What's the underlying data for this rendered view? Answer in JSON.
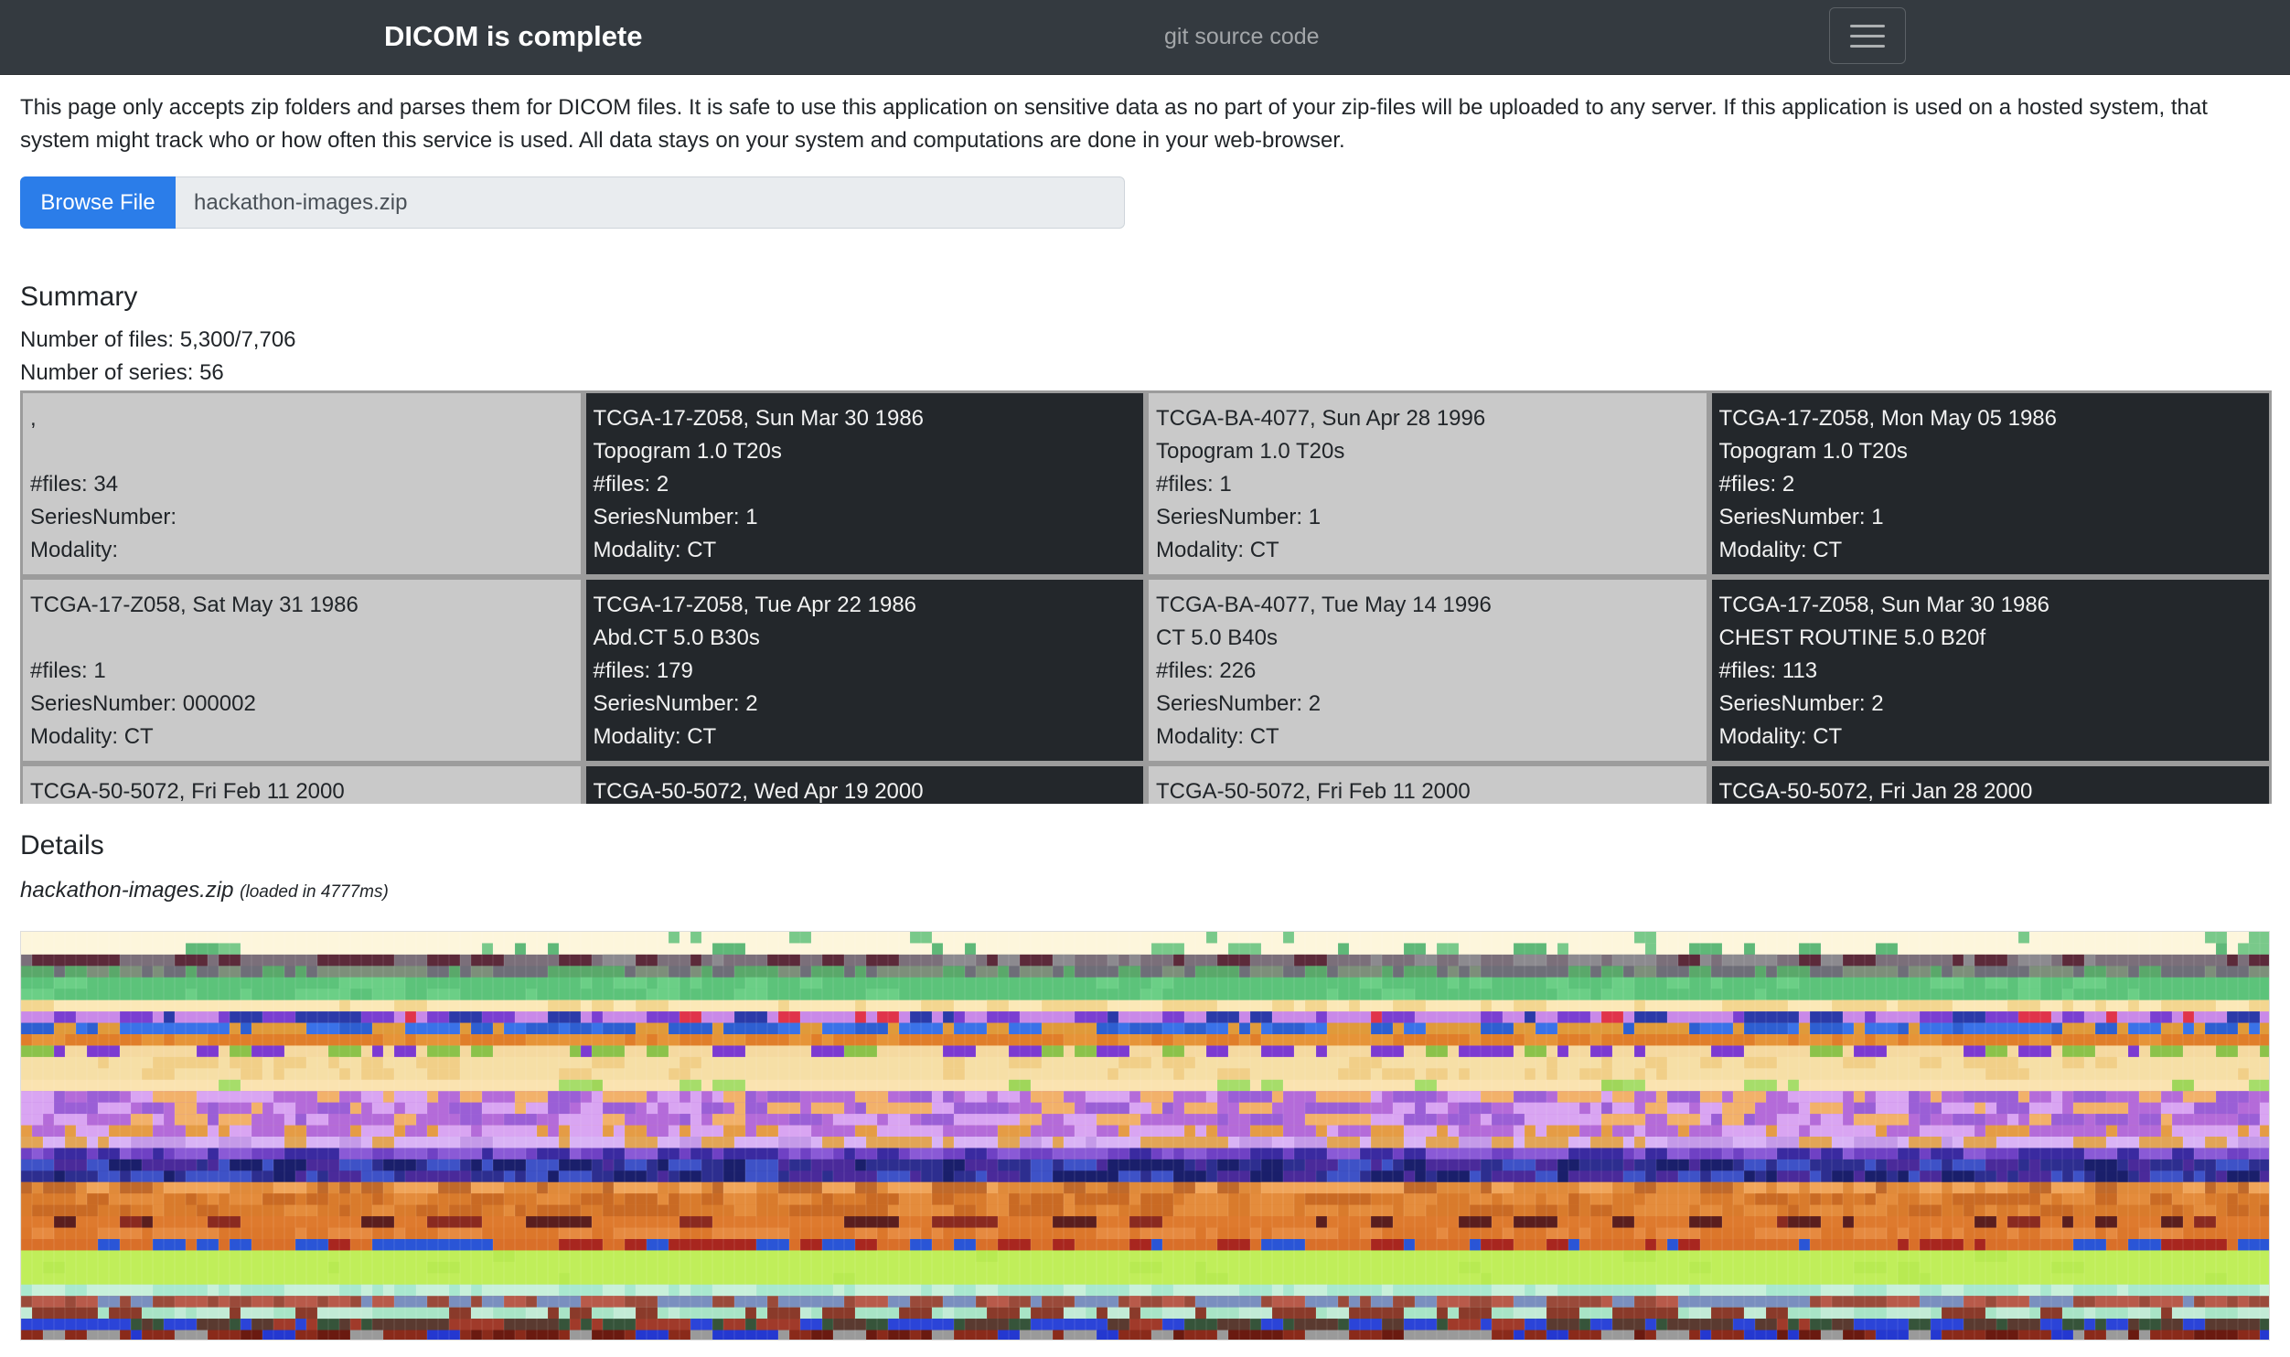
{
  "nav": {
    "brand": "DICOM is complete",
    "link": "git source code"
  },
  "intro": "This page only accepts zip folders and parses them for DICOM files. It is safe to use this application on sensitive data as no part of your zip-files will be uploaded to any server. If this application is used on a hosted system, that system might track who or how often this service is used. All data stays on your system and computations are done in your web-browser.",
  "file": {
    "browse_label": "Browse File",
    "filename": "hackathon-images.zip"
  },
  "summary": {
    "title": "Summary",
    "files": "Number of files: 5,300/7,706",
    "series": "Number of series: 56"
  },
  "cards": [
    {
      "theme": "light",
      "lines": [
        ",",
        "",
        "#files: 34",
        "SeriesNumber:",
        "Modality:"
      ]
    },
    {
      "theme": "dark",
      "lines": [
        "TCGA-17-Z058, Sun Mar 30 1986",
        "Topogram 1.0 T20s",
        "#files: 2",
        "SeriesNumber: 1",
        "Modality: CT"
      ]
    },
    {
      "theme": "light",
      "lines": [
        "TCGA-BA-4077, Sun Apr 28 1996",
        "Topogram 1.0 T20s",
        "#files: 1",
        "SeriesNumber: 1",
        "Modality: CT"
      ]
    },
    {
      "theme": "dark",
      "lines": [
        "TCGA-17-Z058, Mon May 05 1986",
        "Topogram 1.0 T20s",
        "#files: 2",
        "SeriesNumber: 1",
        "Modality: CT"
      ]
    },
    {
      "theme": "light",
      "lines": [
        "TCGA-17-Z058, Sat May 31 1986",
        "",
        "#files: 1",
        "SeriesNumber: 000002",
        "Modality: CT"
      ]
    },
    {
      "theme": "dark",
      "lines": [
        "TCGA-17-Z058, Tue Apr 22 1986",
        "Abd.CT 5.0 B30s",
        "#files: 179",
        "SeriesNumber: 2",
        "Modality: CT"
      ]
    },
    {
      "theme": "light",
      "lines": [
        "TCGA-BA-4077, Tue May 14 1996",
        "CT 5.0 B40s",
        "#files: 226",
        "SeriesNumber: 2",
        "Modality: CT"
      ]
    },
    {
      "theme": "dark",
      "lines": [
        "TCGA-17-Z058, Sun Mar 30 1986",
        "CHEST ROUTINE 5.0 B20f",
        "#files: 113",
        "SeriesNumber: 2",
        "Modality: CT"
      ]
    },
    {
      "theme": "light",
      "lines": [
        "TCGA-50-5072, Fri Feb 11 2000",
        "",
        "",
        "",
        ""
      ]
    },
    {
      "theme": "dark",
      "lines": [
        "TCGA-50-5072, Wed Apr 19 2000",
        "",
        "",
        "",
        ""
      ]
    },
    {
      "theme": "light",
      "lines": [
        "TCGA-50-5072, Fri Feb 11 2000",
        "",
        "",
        "",
        ""
      ]
    },
    {
      "theme": "dark",
      "lines": [
        "TCGA-50-5072, Fri Jan 28 2000",
        "",
        "",
        "",
        ""
      ]
    }
  ],
  "details": {
    "title": "Details",
    "filename": "hackathon-images.zip",
    "load_note": "(loaded in 4777ms)"
  },
  "heatmap": {
    "bands": [
      {
        "rows": 1,
        "base": "#fdf6dc",
        "accents": [
          "#79c98a"
        ],
        "rate": 0.07
      },
      {
        "rows": 1,
        "base": "#fdf6dc",
        "accents": [
          "#79c98a",
          "#5fb878"
        ],
        "rate": 0.1
      },
      {
        "rows": 1,
        "base": "#7b6f7a",
        "accents": [
          "#5c2a3a",
          "#8c8a8f"
        ],
        "rate": 0.4
      },
      {
        "rows": 1,
        "base": "#6e6e78",
        "accents": [
          "#5aa86a",
          "#7d8f7a"
        ],
        "rate": 0.45
      },
      {
        "rows": 2,
        "base": "#5cc37a",
        "accents": [
          "#6bcf86"
        ],
        "rate": 0.1
      },
      {
        "rows": 1,
        "base": "#fbe8b7",
        "accents": [
          "#f3d690"
        ],
        "rate": 0.2
      },
      {
        "rows": 1,
        "base": "#c989e8",
        "accents": [
          "#e0344a",
          "#2b3aa8",
          "#7a3fd1"
        ],
        "rate": 0.35
      },
      {
        "rows": 1,
        "base": "#e09a3a",
        "accents": [
          "#2e5fd1",
          "#3a72e8"
        ],
        "rate": 0.5
      },
      {
        "rows": 1,
        "base": "#e07e2a",
        "accents": [
          "#e69438"
        ],
        "rate": 0.2
      },
      {
        "rows": 1,
        "base": "#f5d9a0",
        "accents": [
          "#8bc24a",
          "#7c3ad1"
        ],
        "rate": 0.35
      },
      {
        "rows": 2,
        "base": "#f6dfa6",
        "accents": [
          "#f1cf88"
        ],
        "rate": 0.15
      },
      {
        "rows": 1,
        "base": "#fae3b0",
        "accents": [
          "#9fd65a",
          "#a6dd6a"
        ],
        "rate": 0.08
      },
      {
        "rows": 3,
        "base": "#b46bd9",
        "accents": [
          "#d9a5f2",
          "#9a5fd6",
          "#f2b16a"
        ],
        "rate": 0.55
      },
      {
        "rows": 1,
        "base": "#e59c45",
        "accents": [
          "#b46bd9",
          "#d9a5f2"
        ],
        "rate": 0.5
      },
      {
        "rows": 1,
        "base": "#d9b3f5",
        "accents": [
          "#c49ae8",
          "#e2a556"
        ],
        "rate": 0.4
      },
      {
        "rows": 1,
        "base": "#6f41c4",
        "accents": [
          "#3a2aa0",
          "#8a5ad6"
        ],
        "rate": 0.55
      },
      {
        "rows": 2,
        "base": "#2d2e8f",
        "accents": [
          "#3e52c7",
          "#4a2a9a",
          "#1a1f6b"
        ],
        "rate": 0.55
      },
      {
        "rows": 1,
        "base": "#e08a3a",
        "accents": [
          "#c0692a",
          "#f0a55a"
        ],
        "rate": 0.5
      },
      {
        "rows": 2,
        "base": "#d97b2c",
        "accents": [
          "#e48c3c",
          "#c96a24"
        ],
        "rate": 0.45
      },
      {
        "rows": 1,
        "base": "#de7a2e",
        "accents": [
          "#5a1e1e",
          "#8a2a20"
        ],
        "rate": 0.18
      },
      {
        "rows": 1,
        "base": "#dc772b",
        "accents": [
          "#e68a40"
        ],
        "rate": 0.3
      },
      {
        "rows": 1,
        "base": "#d96f29",
        "accents": [
          "#a8261f",
          "#2a55d6"
        ],
        "rate": 0.3
      },
      {
        "rows": 3,
        "base": "#c0ee5a",
        "accents": [
          "#b8ea52"
        ],
        "rate": 0.05
      },
      {
        "rows": 1,
        "base": "#a9e8cf",
        "accents": [
          "#c8f0da"
        ],
        "rate": 0.3
      },
      {
        "rows": 1,
        "base": "#9a4a3a",
        "accents": [
          "#b85a4a",
          "#7a8fbf"
        ],
        "rate": 0.5
      },
      {
        "rows": 1,
        "base": "#a8e4c6",
        "accents": [
          "#8a3a2a",
          "#c2ebd6"
        ],
        "rate": 0.45
      },
      {
        "rows": 1,
        "base": "#36543a",
        "accents": [
          "#2b44d8",
          "#a03a2a",
          "#5a3a30"
        ],
        "rate": 0.55
      },
      {
        "rows": 1,
        "base": "#8a2a1a",
        "accents": [
          "#2438d0",
          "#9a9a9a",
          "#6a1a10"
        ],
        "rate": 0.55
      }
    ]
  }
}
